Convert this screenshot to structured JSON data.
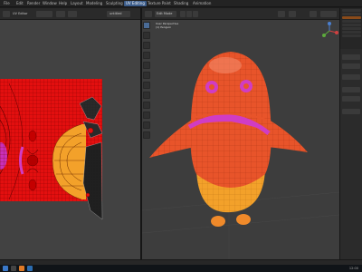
{
  "topbar": {
    "menus": [
      "File",
      "Edit",
      "Render",
      "Window",
      "Help",
      "Layout",
      "Modeling",
      "Sculpting",
      "UV Editing",
      "Texture Paint",
      "Shading",
      "Animation"
    ],
    "active_menu": "UV Editing"
  },
  "uv_editor": {
    "header_label": "UV Editor",
    "image_name": "untitled"
  },
  "viewport": {
    "header_label": "Edit Mode",
    "view_name": "User Perspective",
    "object_name": "(1) Penguin"
  },
  "taskbar": {
    "clock": "12:00"
  },
  "colors": {
    "accent": "#3b5c8a",
    "uv_texture_red": "#e30f0f",
    "body_orange": "#e8542a",
    "belly_yellow": "#f3a12a",
    "magenta": "#d03cc4"
  }
}
